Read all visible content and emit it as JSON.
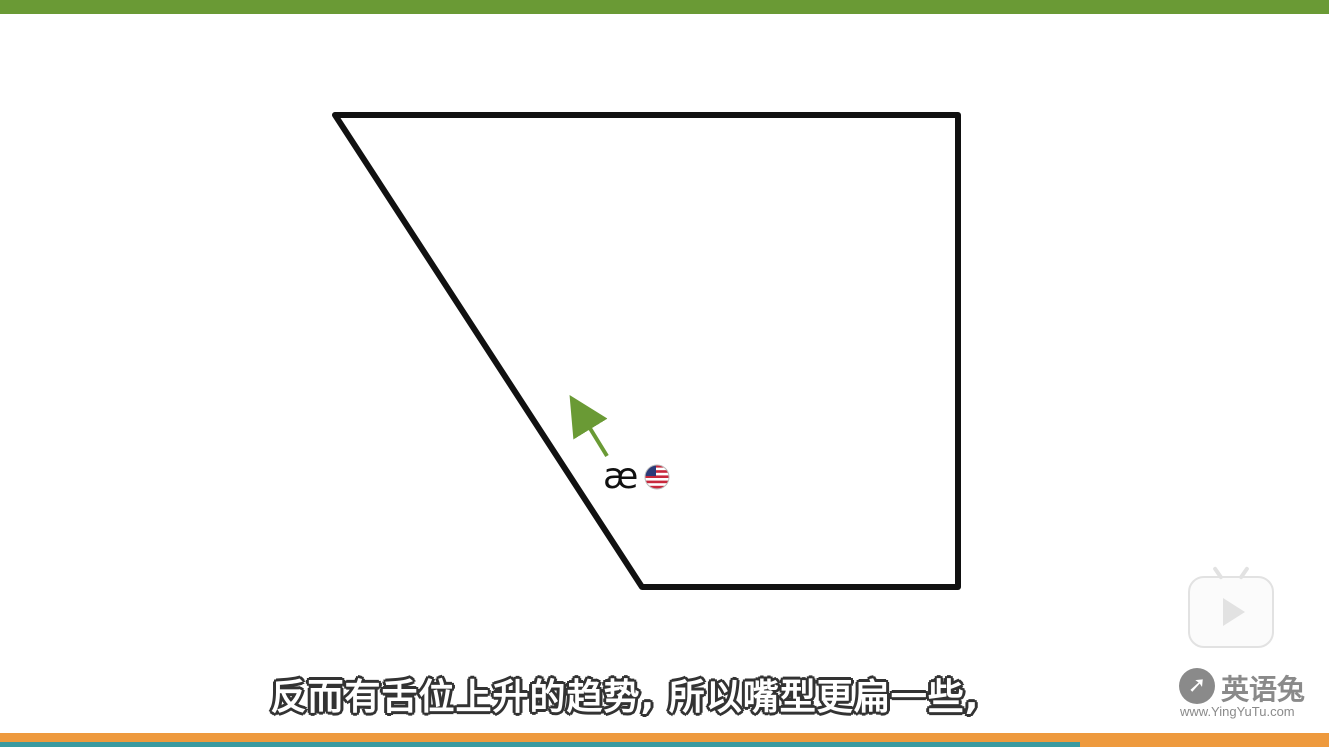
{
  "diagram": {
    "ipa_symbol": "æ",
    "flag_icon": "us-flag-icon",
    "arrow_color": "#6a9a35",
    "outline_color": "#111111"
  },
  "subtitle": "反而有舌位上升的趋势, 所以嘴型更扁一些,",
  "watermark": {
    "name": "英语兔",
    "url": "www.YingYuTu.com",
    "icon": "rabbit-logo-icon"
  },
  "player": {
    "icon": "play-icon"
  },
  "colors": {
    "top_bar": "#6a9a35",
    "bottom_bar": "#ee9a3e",
    "bottom_accent": "#3a9aa0"
  }
}
